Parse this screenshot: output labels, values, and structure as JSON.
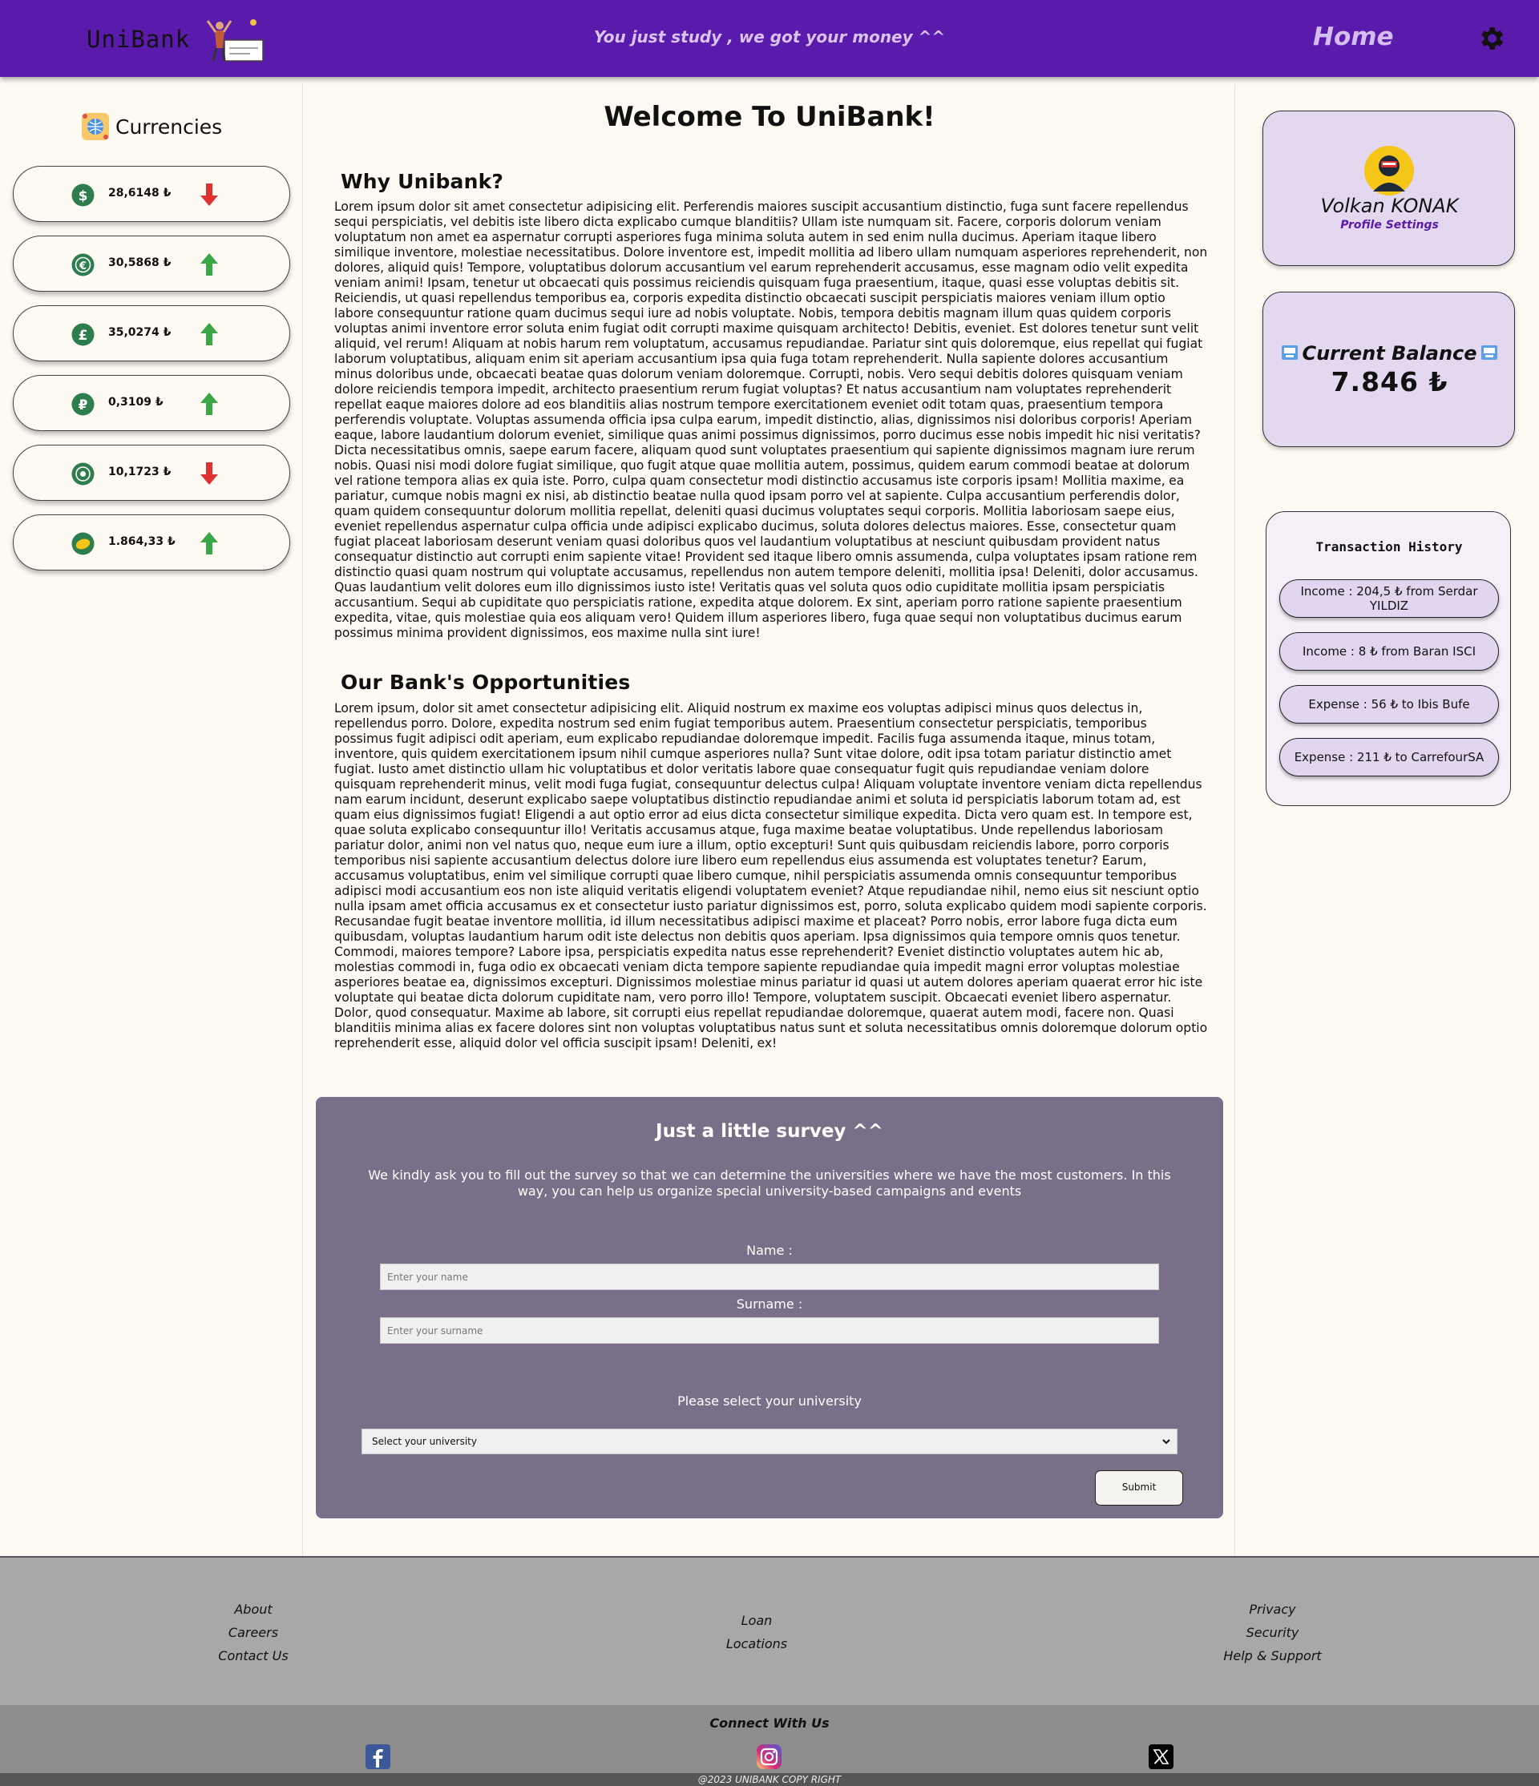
{
  "header": {
    "logo_text": "UniBank",
    "tagline": "You just study , we got your money ^^",
    "home_label": "Home"
  },
  "currencies": {
    "title": "Currencies",
    "items": [
      {
        "icon": "dollar-icon",
        "value": "28,6148 ₺",
        "trend": "down"
      },
      {
        "icon": "euro-icon",
        "value": "30,5868 ₺",
        "trend": "up"
      },
      {
        "icon": "pound-icon",
        "value": "35,0274 ₺",
        "trend": "up"
      },
      {
        "icon": "ruble-icon",
        "value": "0,3109 ₺",
        "trend": "up"
      },
      {
        "icon": "crypto-icon",
        "value": "10,1723 ₺",
        "trend": "down"
      },
      {
        "icon": "gold-icon",
        "value": "1.864,33 ₺",
        "trend": "up"
      }
    ]
  },
  "main": {
    "welcome": "Welcome To UniBank!",
    "why_title": "Why Unibank?",
    "why_text": "Lorem ipsum dolor sit amet consectetur adipisicing elit. Perferendis maiores suscipit accusantium distinctio, fuga sunt facere repellendus sequi perspiciatis, vel debitis iste libero dicta explicabo cumque blanditiis? Ullam iste numquam sit. Facere, corporis dolorum veniam voluptatum non amet ea aspernatur corrupti asperiores fuga minima soluta autem in sed enim nulla ducimus. Aperiam itaque libero similique inventore, molestiae necessitatibus. Dolore inventore est, impedit mollitia ad libero ullam numquam asperiores reprehenderit, non dolores, aliquid quis! Tempore, voluptatibus dolorum accusantium vel earum reprehenderit accusamus, esse magnam odio velit expedita veniam animi! Ipsam, tenetur ut obcaecati quis possimus reiciendis quisquam fuga praesentium, itaque, quasi esse voluptas debitis sit. Reiciendis, ut quasi repellendus temporibus ea, corporis expedita distinctio obcaecati suscipit perspiciatis maiores veniam illum optio labore consequuntur ratione quam ducimus sequi iure ad nobis voluptate. Nobis, tempora debitis magnam illum quas quidem corporis voluptas animi inventore error soluta enim fugiat odit corrupti maxime quisquam architecto! Debitis, eveniet. Est dolores tenetur sunt velit aliquid, vel rerum! Aliquam at nobis harum rem voluptatum, accusamus repudiandae. Pariatur sint quis doloremque, eius repellat qui fugiat laborum voluptatibus, aliquam enim sit aperiam accusantium ipsa quia fuga totam reprehenderit. Nulla sapiente dolores accusantium minus doloribus unde, obcaecati beatae quas dolorum veniam doloremque. Corrupti, nobis. Vero sequi debitis dolores quisquam veniam dolore reiciendis tempora impedit, architecto praesentium rerum fugiat voluptas? Et natus accusantium nam voluptates reprehenderit repellat eaque maiores dolore ad eos blanditiis alias nostrum tempore exercitationem eveniet odit totam quas, praesentium tempora perferendis voluptate. Voluptas assumenda officia ipsa culpa earum, impedit distinctio, alias, dignissimos nisi doloribus corporis! Aperiam eaque, labore laudantium dolorum eveniet, similique quas animi possimus dignissimos, porro ducimus esse nobis impedit hic nisi veritatis? Dicta necessitatibus omnis, saepe earum facere, aliquam quod sunt voluptates praesentium qui sapiente dignissimos magnam iure rerum nobis. Quasi nisi modi dolore fugiat similique, quo fugit atque quae mollitia autem, possimus, quidem earum commodi beatae at dolorum vel ratione tempora alias ex quia iste. Porro, culpa quam consectetur modi distinctio accusamus iste corporis ipsam! Mollitia maxime, ea pariatur, cumque nobis magni ex nisi, ab distinctio beatae nulla quod ipsam porro vel at sapiente. Culpa accusantium perferendis dolor, quam quidem consequuntur dolorum mollitia repellat, deleniti quasi ducimus voluptates sequi corporis. Mollitia laboriosam saepe eius, eveniet repellendus aspernatur culpa officia unde adipisci explicabo ducimus, soluta dolores delectus maiores. Esse, consectetur quam fugiat placeat laboriosam deserunt veniam quasi doloribus quos vel laudantium voluptatibus at nesciunt quibusdam provident natus consequatur distinctio aut corrupti enim sapiente vitae! Provident sed itaque libero omnis assumenda, culpa voluptates ipsam ratione rem distinctio quasi quam nostrum qui voluptate accusamus, repellendus non autem tempore deleniti, mollitia ipsa! Deleniti, dolor accusamus. Quas laudantium velit dolores eum illo dignissimos iusto iste! Veritatis quas vel soluta quos odio cupiditate mollitia ipsam perspiciatis accusantium. Sequi ab cupiditate quo perspiciatis ratione, expedita atque dolorem. Ex sint, aperiam porro ratione sapiente praesentium expedita, vitae, quis molestiae quia eos aliquam vero! Quidem illum asperiores libero, fuga quae sequi non voluptatibus ducimus earum possimus minima provident dignissimos, eos maxime nulla sint iure!",
    "opp_title": "Our Bank's Opportunities",
    "opp_text": "Lorem ipsum, dolor sit amet consectetur adipisicing elit. Aliquid nostrum ex maxime eos voluptas adipisci minus quos delectus in, repellendus porro. Dolore, expedita nostrum sed enim fugiat temporibus autem. Praesentium consectetur perspiciatis, temporibus possimus fugit adipisci odit aperiam, eum explicabo repudiandae doloremque impedit. Facilis fuga assumenda itaque, minus totam, inventore, quis quidem exercitationem ipsum nihil cumque asperiores nulla? Sunt vitae dolore, odit ipsa totam pariatur distinctio amet fugiat. Iusto amet distinctio ullam hic voluptatibus et dolor veritatis labore quae consequatur fugit quis repudiandae veniam dolore quisquam reprehenderit minus, velit modi fuga fugiat, consequuntur delectus culpa! Aliquam voluptate inventore veniam dicta repellendus nam earum incidunt, deserunt explicabo saepe voluptatibus distinctio repudiandae animi et soluta id perspiciatis laborum totam ad, est quam eius dignissimos fugiat! Eligendi a aut optio error ad eius dicta consectetur similique expedita. Dicta vero quam est. In tempore est, quae soluta explicabo consequuntur illo! Veritatis accusamus atque, fuga maxime beatae voluptatibus. Unde repellendus laboriosam pariatur dolor, animi non vel natus quo, neque eum iure a illum, optio excepturi! Sunt quis quibusdam reiciendis labore, porro corporis temporibus nisi sapiente accusantium delectus dolore iure libero eum repellendus eius assumenda est voluptates tenetur? Earum, accusamus voluptatibus, enim vel similique corrupti quae libero cumque, nihil perspiciatis assumenda omnis consequuntur temporibus adipisci modi accusantium eos non iste aliquid veritatis eligendi voluptatem eveniet? Atque repudiandae nihil, nemo eius sit nesciunt optio nulla ipsam amet officia accusamus ex et consectetur iusto pariatur dignissimos est, porro, soluta explicabo quidem modi sapiente corporis. Recusandae fugit beatae inventore mollitia, id illum necessitatibus adipisci maxime et placeat? Porro nobis, error labore fuga dicta eum quibusdam, voluptas laudantium harum odit iste delectus non debitis quos aperiam. Ipsa dignissimos quia tempore omnis quos tenetur. Commodi, maiores tempore? Labore ipsa, perspiciatis expedita natus esse reprehenderit? Eveniet distinctio voluptates autem hic ab, molestias commodi in, fuga odio ex obcaecati veniam dicta tempore sapiente repudiandae quia impedit magni error voluptas molestiae asperiores beatae ea, dignissimos excepturi. Dignissimos molestiae minus pariatur id quasi ut autem dolores aperiam quaerat error hic iste voluptate qui beatae dicta dolorum cupiditate nam, vero porro illo! Tempore, voluptatem suscipit. Obcaecati eveniet libero aspernatur. Dolor, quod consequatur. Maxime ab labore, sit corrupti eius repellat repudiandae doloremque, quaerat autem modi, facere non. Quasi blanditiis minima alias ex facere dolores sint non voluptas voluptatibus natus sunt et soluta necessitatibus omnis doloremque dolorum optio reprehenderit esse, aliquid dolor vel officia suscipit ipsam! Deleniti, ex!"
  },
  "survey": {
    "title": "Just a little survey ^^",
    "description": "We kindly ask you to fill out the survey so that we can determine the universities where we have the most customers. In this way, you can help us organize special university-based campaigns and events",
    "name_label": "Name :",
    "name_placeholder": "Enter your name",
    "surname_label": "Surname :",
    "surname_placeholder": "Enter your surname",
    "university_label": "Please select your university",
    "university_selected": "Select your university",
    "submit_label": "Submit"
  },
  "profile": {
    "name": "Volkan KONAK",
    "settings_label": "Profile Settings"
  },
  "balance": {
    "title": "Current Balance",
    "amount": "7.846 ₺"
  },
  "transactions": {
    "title": "Transaction History",
    "items": [
      "Income : 204,5 ₺ from Serdar YILDIZ",
      "Income : 8 ₺ from Baran ISCI",
      "Expense : 56 ₺ to Ibis Bufe",
      "Expense : 211 ₺ to CarrefourSA"
    ]
  },
  "footer": {
    "col1": [
      "About",
      "Careers",
      "Contact Us"
    ],
    "col2": [
      "Loan",
      "Locations"
    ],
    "col3": [
      "Privacy",
      "Security",
      "Help & Support"
    ],
    "connect_title": "Connect With Us",
    "copyright": "@2023 UNIBANK COPY RIGHT",
    "socials": [
      "facebook-icon",
      "instagram-icon",
      "x-icon"
    ]
  },
  "colors": {
    "header_bg": "#5a1aab",
    "card_bg": "#e4d8f1",
    "survey_bg": "#7a6f88",
    "arrow_up": "#3aa645",
    "arrow_down": "#e03131",
    "currency_icon": "#2e7d4f"
  }
}
